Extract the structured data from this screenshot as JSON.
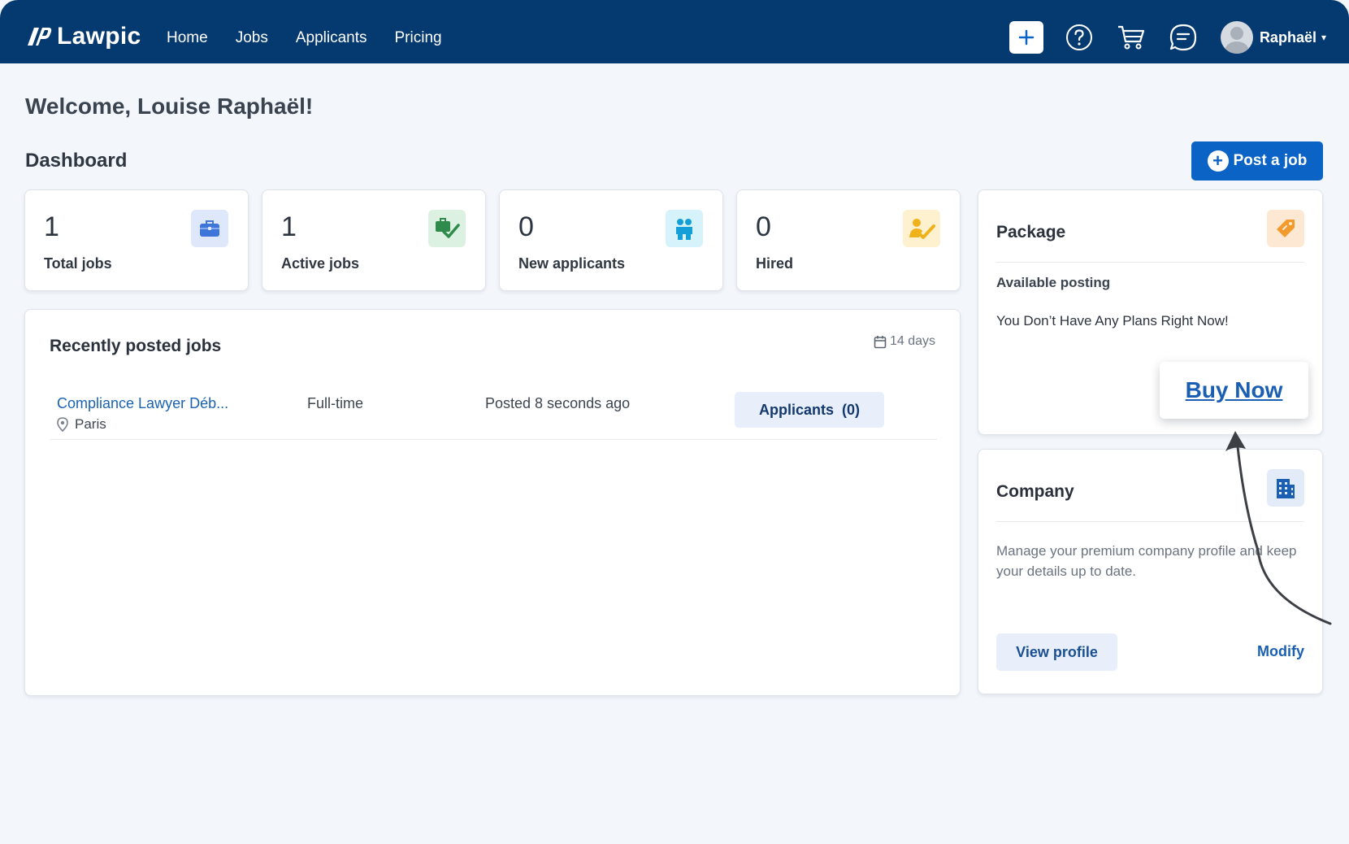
{
  "nav": {
    "brand": "Lawpic",
    "links": [
      "Home",
      "Jobs",
      "Applicants",
      "Pricing"
    ],
    "user_name": "Raphaël",
    "icons": [
      "plus-icon",
      "help-icon",
      "cart-icon",
      "chat-icon",
      "avatar",
      "chevron-down-icon"
    ]
  },
  "welcome": "Welcome, Louise Raphaël!",
  "dashboard_title": "Dashboard",
  "post_job_label": "Post a job",
  "stats": [
    {
      "value": "1",
      "label": "Total jobs",
      "icon": "briefcase-icon"
    },
    {
      "value": "1",
      "label": "Active jobs",
      "icon": "checked-briefcase-icon"
    },
    {
      "value": "0",
      "label": "New applicants",
      "icon": "people-icon"
    },
    {
      "value": "0",
      "label": "Hired",
      "icon": "hired-person-icon"
    }
  ],
  "recent": {
    "title": "Recently posted jobs",
    "range": "14 days",
    "jobs": [
      {
        "title": "Compliance Lawyer Déb...",
        "location": "Paris",
        "type": "Full-time",
        "posted": "Posted 8 seconds ago",
        "applicants_label": "Applicants  (0)"
      }
    ]
  },
  "package": {
    "title": "Package",
    "available_label": "Available posting",
    "no_plan_text": "You Don’t Have Any Plans Right Now!",
    "buy_now_label": "Buy Now"
  },
  "company": {
    "title": "Company",
    "description": "Manage your premium company profile and keep your details up to date.",
    "view_profile_label": "View profile",
    "modify_label": "Modify"
  },
  "colors": {
    "nav_bg": "#053a70",
    "primary": "#0c63c6",
    "link": "#1a63b3",
    "page_bg": "#f3f6fb"
  }
}
